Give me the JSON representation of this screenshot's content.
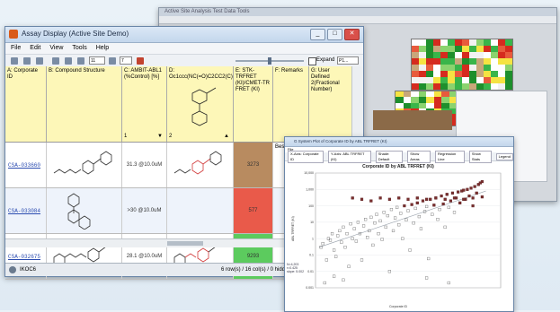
{
  "back_window": {
    "title": "Active Site Analysis    Test Data    Tools",
    "heatmap_colors": [
      "#1e8f2c",
      "#39b54a",
      "#8bd36e",
      "#d52b1e",
      "#e85a3c",
      "#f2f2f2",
      "#c8a77a",
      "#f5e342",
      "#ffffff"
    ]
  },
  "main_window": {
    "title": "Assay Display (Active Site Demo)",
    "menu": [
      "File",
      "Edit",
      "View",
      "Tools",
      "Help"
    ],
    "toolbar": {
      "combo": "11",
      "combo2": "7",
      "expand_label": "Expand",
      "expand_value": "P1..."
    },
    "columns": [
      "A: Corporate ID",
      "B: Compound Structure",
      "C: AMBIT-ABL1 (%Control) [%]",
      "D: Oc1ccc(NC(=O)C2CC2(C)...",
      "E: STK-TRFRET (KI)/CMET-TR FRET (KI)",
      "F: Remarks",
      "G: User Defined 2(Fractional Number)"
    ],
    "rows": [
      {
        "id": "CSA-033660",
        "ambit": "31.3 @10.0uM",
        "value": "3273",
        "remark": "Best one yet",
        "color": "#b88b60"
      },
      {
        "id": "CSA-033084",
        "ambit": ">30 @10.0uM",
        "value": "577",
        "remark": "",
        "color": "#e95a4a"
      },
      {
        "id": "CSA-032675",
        "ambit": "28.1 @10.0uM",
        "value": "9293",
        "remark": "",
        "color": "#5ccb5e"
      }
    ],
    "status_left": "IKOC6",
    "status_right": "6 row(s) / 16 col(s) / 0 hidden"
  },
  "plot_window": {
    "title": "G System Plot of Corporate ID by ABL TRFRET (KI)",
    "menu": "File",
    "controls": [
      "X-Axis: Corporate ID",
      "Y-Axis: ABL TRFRET (KI)",
      "Shade: Default",
      "Show Areas",
      "Regression Line",
      "Show Stats",
      "Legend"
    ],
    "chart_title": "Corporate ID by ABL TRFRET (KI)",
    "y_label": "ABL TRFRET (KI)",
    "x_label": "Corporate ID",
    "stats": "N=4,203 r=0.425 slope: 5.002",
    "chart_data": {
      "type": "scatter",
      "title": "Corporate ID by ABL TRFRET (KI)",
      "ylabel": "ABL TRFRET (KI)",
      "xlabel": "Corporate ID",
      "yscale": "log",
      "y_ticks": [
        "10,000",
        "1,000",
        "100",
        "10",
        "1",
        "0.1",
        "0.01",
        "0.001"
      ],
      "ylim": [
        0.001,
        10000
      ],
      "xlim": [
        0,
        100
      ],
      "series": [
        {
          "name": "Corporate ID",
          "points": [
            [
              3,
              0.3
            ],
            [
              4,
              0.5
            ],
            [
              5,
              0.002
            ],
            [
              6,
              0.05
            ],
            [
              7,
              1
            ],
            [
              8,
              0.8
            ],
            [
              9,
              2
            ],
            [
              10,
              0.2
            ],
            [
              11,
              0.08
            ],
            [
              12,
              1.5
            ],
            [
              13,
              3
            ],
            [
              14,
              0.6
            ],
            [
              15,
              5
            ],
            [
              16,
              0.3
            ],
            [
              17,
              2
            ],
            [
              18,
              0.02
            ],
            [
              19,
              8
            ],
            [
              20,
              1
            ],
            [
              21,
              4
            ],
            [
              22,
              0.7
            ],
            [
              23,
              10
            ],
            [
              24,
              2
            ],
            [
              25,
              0.05
            ],
            [
              26,
              6
            ],
            [
              27,
              15
            ],
            [
              28,
              1.2
            ],
            [
              29,
              3
            ],
            [
              30,
              20
            ],
            [
              31,
              0.4
            ],
            [
              32,
              9
            ],
            [
              33,
              30
            ],
            [
              34,
              2
            ],
            [
              35,
              12
            ],
            [
              36,
              0.9
            ],
            [
              37,
              40
            ],
            [
              38,
              5
            ],
            [
              39,
              25
            ],
            [
              40,
              0.01
            ],
            [
              41,
              60
            ],
            [
              42,
              3
            ],
            [
              43,
              18
            ],
            [
              44,
              80
            ],
            [
              45,
              7
            ],
            [
              46,
              35
            ],
            [
              47,
              1
            ],
            [
              48,
              100
            ],
            [
              49,
              14
            ],
            [
              50,
              50
            ],
            [
              51,
              0.2
            ],
            [
              52,
              120
            ],
            [
              53,
              9
            ],
            [
              54,
              70
            ],
            [
              55,
              150
            ],
            [
              56,
              22
            ],
            [
              57,
              4
            ],
            [
              58,
              200
            ],
            [
              59,
              45
            ],
            [
              60,
              90
            ],
            [
              61,
              0.06
            ],
            [
              62,
              250
            ],
            [
              63,
              30
            ],
            [
              64,
              110
            ],
            [
              65,
              300
            ],
            [
              66,
              15
            ],
            [
              67,
              60
            ],
            [
              68,
              400
            ],
            [
              69,
              130
            ],
            [
              70,
              5
            ],
            [
              71,
              500
            ],
            [
              72,
              80
            ],
            [
              73,
              200
            ],
            [
              74,
              600
            ],
            [
              75,
              40
            ],
            [
              76,
              300
            ],
            [
              77,
              700
            ],
            [
              78,
              150
            ],
            [
              79,
              800
            ],
            [
              80,
              900
            ],
            [
              81,
              250
            ],
            [
              82,
              1000
            ],
            [
              83,
              400
            ],
            [
              84,
              1200
            ],
            [
              85,
              100
            ],
            [
              86,
              1500
            ],
            [
              87,
              600
            ],
            [
              88,
              2000
            ],
            [
              89,
              2500
            ],
            [
              90,
              3000
            ],
            [
              20,
              300
            ],
            [
              25,
              250
            ],
            [
              30,
              200
            ],
            [
              35,
              300
            ],
            [
              40,
              250
            ],
            [
              45,
              300
            ],
            [
              50,
              250
            ],
            [
              55,
              300
            ],
            [
              60,
              250
            ],
            [
              65,
              300
            ],
            [
              70,
              250
            ],
            [
              75,
              300
            ],
            [
              80,
              250
            ],
            [
              85,
              300
            ],
            [
              90,
              350
            ],
            [
              10,
              0.005
            ],
            [
              15,
              0.003
            ],
            [
              60,
              0.004
            ],
            [
              72,
              0.002
            ]
          ]
        }
      ],
      "regression": [
        [
          2,
          0.3
        ],
        [
          92,
          800
        ]
      ]
    }
  }
}
